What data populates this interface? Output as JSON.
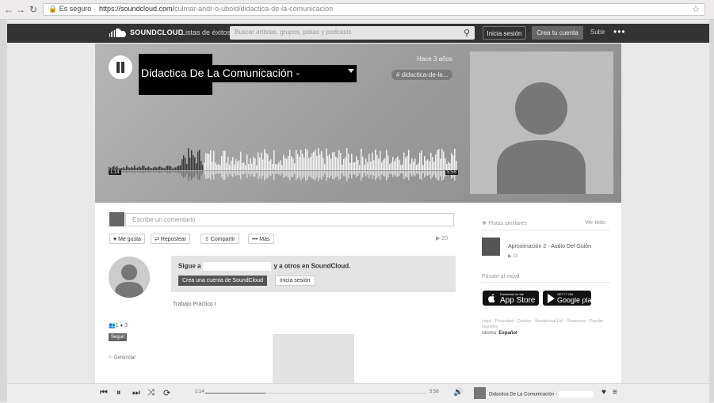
{
  "browser": {
    "secure_label": "Es seguro",
    "url": "https://soundcloud.com/",
    "url_path": "culmar-andr-o-ubold/didactica-de-la-comunicacion"
  },
  "header": {
    "logo": "SOUNDCLOUD",
    "charts": "Listas de éxitos",
    "search_placeholder": "Buscar artistas, grupos, pistas y podcasts",
    "login": "Inicia sesión",
    "create_account": "Crea tu cuenta",
    "upload": "Subir",
    "more": "•••"
  },
  "hero": {
    "title": "Didactica De La Comunicación - ",
    "time_ago": "Hace 3 años",
    "tag": "# didactica-de-la...",
    "current_time": "1:14",
    "total_time": "5:56",
    "progress": 0.27
  },
  "comments": {
    "placeholder": "Escribe un comentario",
    "like": "Me gusta",
    "repost": "Repostear",
    "share": "Compartir",
    "more": "Más",
    "plays": "▶ 20"
  },
  "promo": {
    "prefix": "Sigue a",
    "suffix": "y a otros en SoundCloud.",
    "create": "Crea una cuenta de SoundCloud",
    "login": "Inicia sesión"
  },
  "description": "Trabajo Práctico I",
  "user": {
    "stats": "👥1  ♦ 3",
    "follow": "Seguir",
    "report": "⚐ Denunciar"
  },
  "sidebar": {
    "similar": "Pistas similares",
    "see_all": "Ver todo",
    "track": "Aproximación 2 - Audio Del Guión",
    "track_plays": "▶ 11",
    "mobile": "Pásate al móvil",
    "appstore_small": "Download on the",
    "appstore_big": "App Store",
    "google_small": "GET IT ON",
    "google_big": "Google play",
    "legal": "Legal · Privacidad · Cookies · Soundcloud Ltd. · Resources · Popular searches",
    "language_label": "Idioma:",
    "language_value": "Español"
  },
  "player": {
    "current": "1:14",
    "total": "5:56",
    "title": "Didactica De La Comunicación -"
  }
}
